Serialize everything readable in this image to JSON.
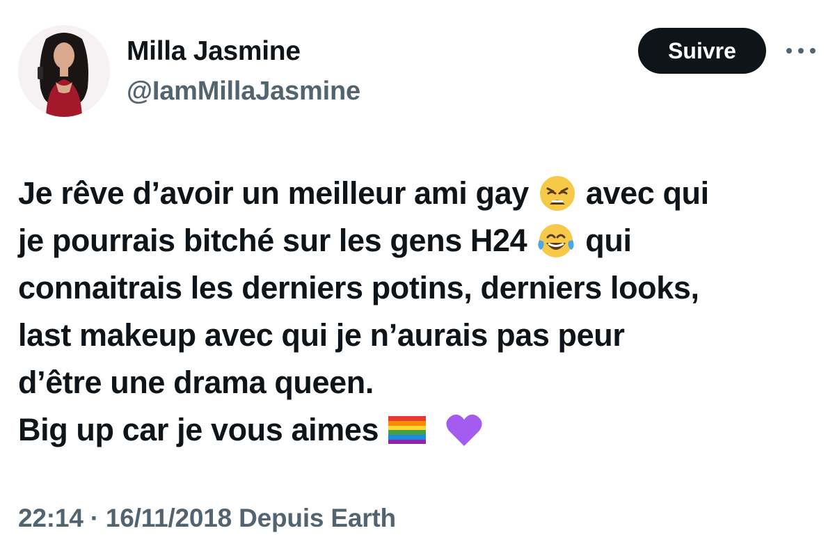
{
  "author": {
    "display_name": "Milla Jasmine",
    "handle": "@IamMillaJasmine"
  },
  "follow_button_label": "Suivre",
  "more_icon": "more-horizontal-icon",
  "tweet": {
    "lines": [
      {
        "text": "Je rêve d’avoir un meilleur ami gay",
        "emoji": "weary-face-emoji",
        "after": "avec qui"
      },
      {
        "text": "je pourrais bitché sur les gens H24",
        "emoji": "tears-of-joy-emoji",
        "after": "qui"
      },
      {
        "text": "connaitrais les derniers potins, derniers looks,"
      },
      {
        "text": "last makeup avec qui je n’aurais pas peur"
      },
      {
        "text": "d’être une drama queen."
      },
      {
        "text": "Big up car je vous aimes",
        "emoji": "rainbow-flag-emoji",
        "emoji2": "purple-heart-emoji"
      }
    ]
  },
  "meta": {
    "timestamp": "22:14 · 16/11/2018 Depuis Earth"
  },
  "colors": {
    "text": "#0f1419",
    "secondary": "#536471",
    "button_bg": "#0f1419",
    "button_text": "#ffffff"
  }
}
